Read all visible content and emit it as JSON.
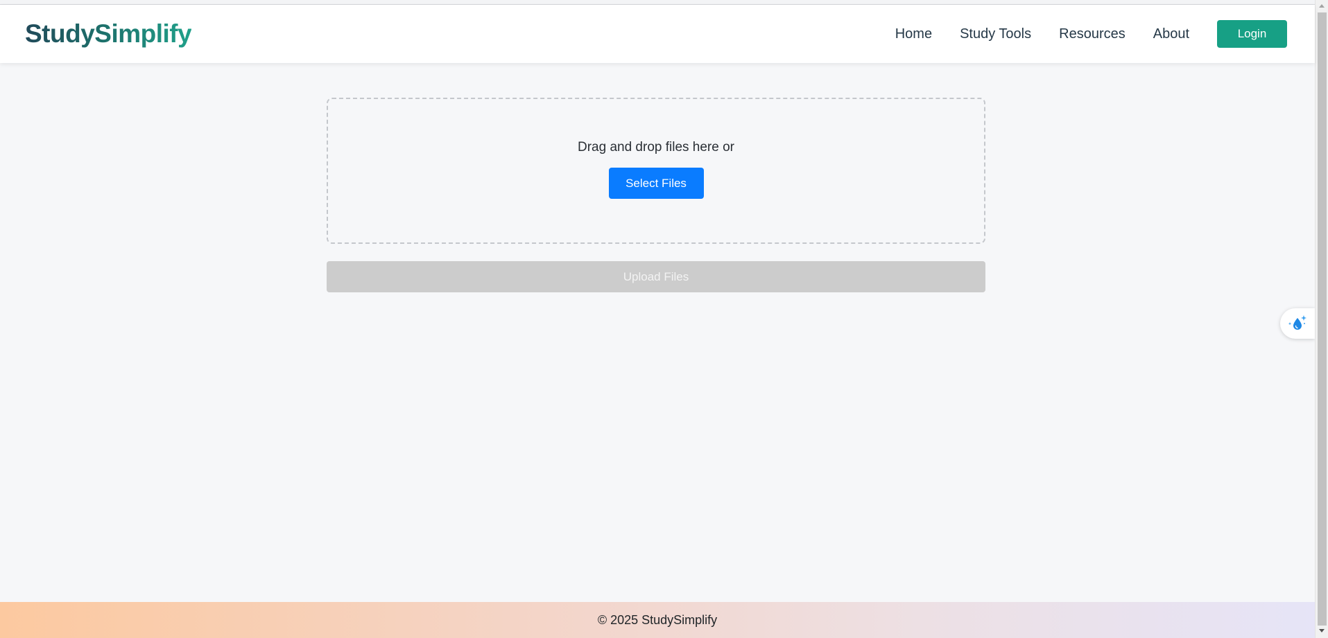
{
  "header": {
    "logo": "StudySimplify",
    "nav": [
      {
        "label": "Home"
      },
      {
        "label": "Study Tools"
      },
      {
        "label": "Resources"
      },
      {
        "label": "About"
      }
    ],
    "login_label": "Login"
  },
  "upload": {
    "drop_text": "Drag and drop files here or",
    "select_label": "Select Files",
    "upload_label": "Upload Files"
  },
  "footer": {
    "text": "© 2025 StudySimplify"
  },
  "colors": {
    "accent": "#17a085",
    "primary_button": "#0a7cff",
    "disabled_button": "#cccccc"
  },
  "widget": {
    "icon": "sparkle-drop-icon"
  }
}
